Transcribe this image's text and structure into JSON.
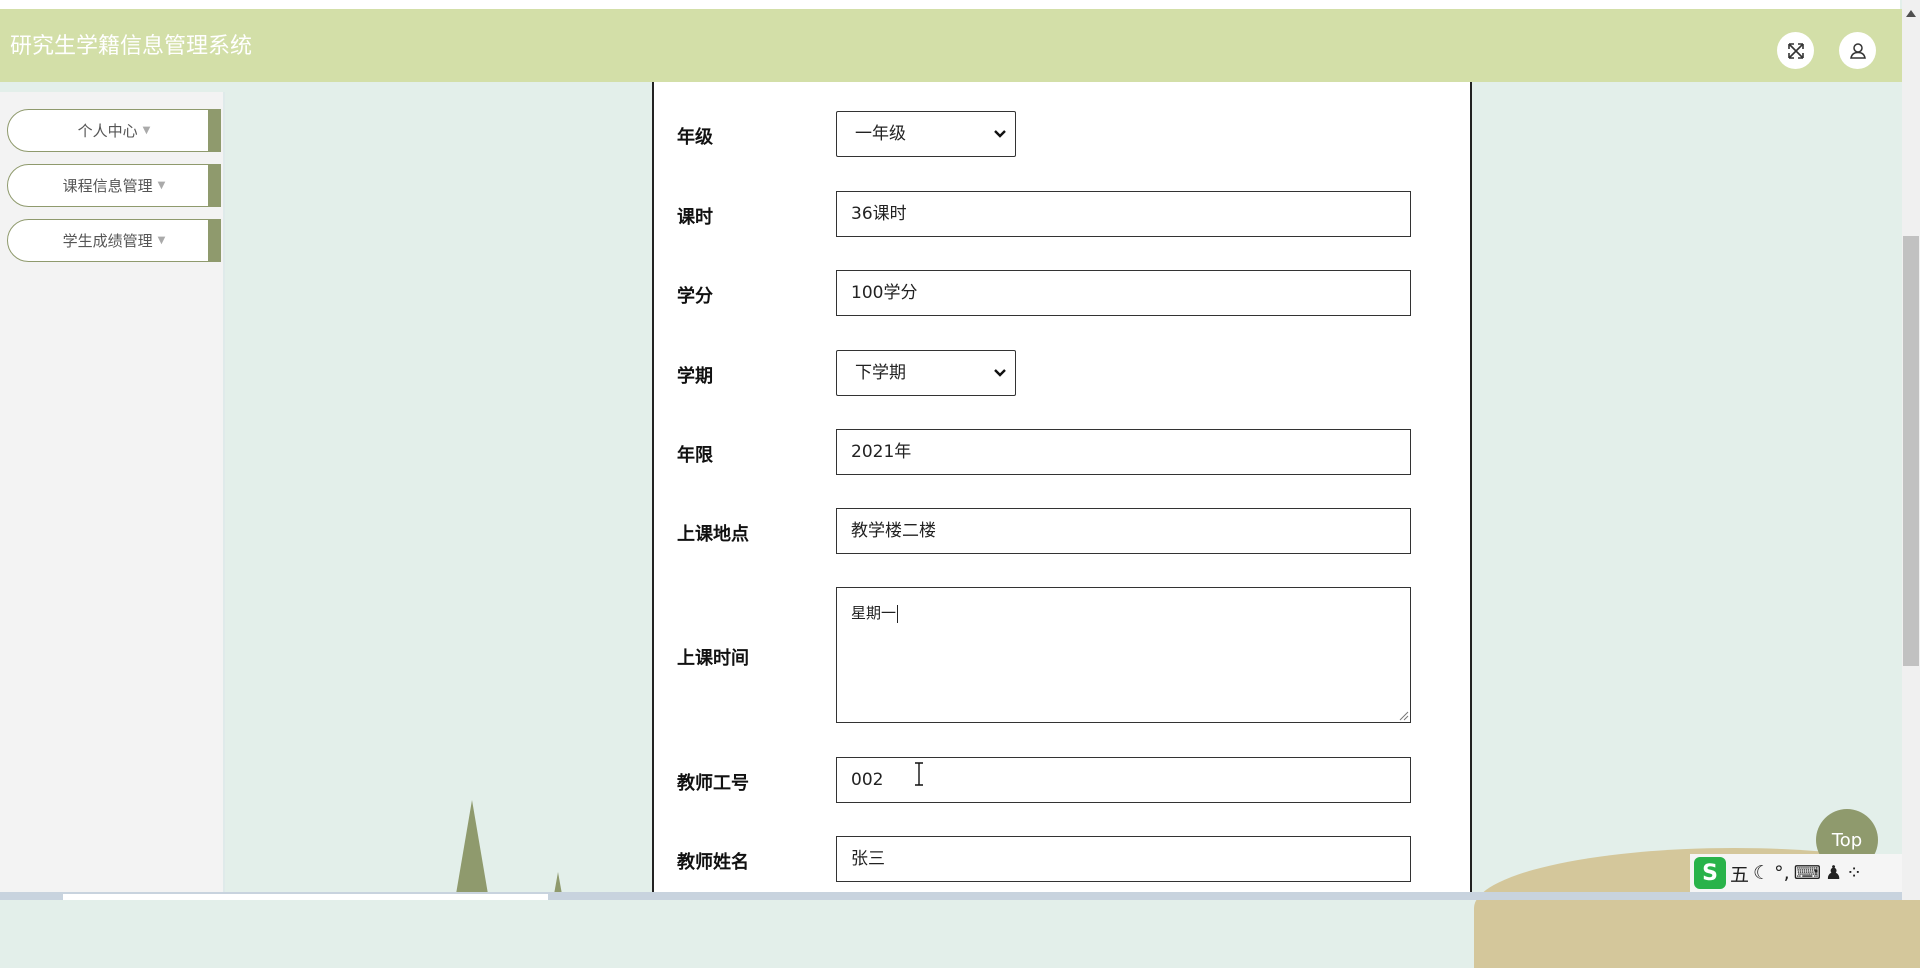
{
  "header": {
    "title": "研究生学籍信息管理系统"
  },
  "icons": {
    "fullscreen": "expand-arrows-icon",
    "user": "user-icon"
  },
  "sidebar": {
    "items": [
      {
        "label": "个人中心"
      },
      {
        "label": "课程信息管理"
      },
      {
        "label": "学生成绩管理"
      }
    ]
  },
  "form": {
    "grade": {
      "label": "年级",
      "value": "一年级"
    },
    "hours": {
      "label": "课时",
      "value": "36课时"
    },
    "credits": {
      "label": "学分",
      "value": "100学分"
    },
    "semester": {
      "label": "学期",
      "value": "下学期"
    },
    "year": {
      "label": "年限",
      "value": "2021年"
    },
    "location": {
      "label": "上课地点",
      "value": "教学楼二楼"
    },
    "time": {
      "label": "上课时间",
      "value": "星期一"
    },
    "teacher_id": {
      "label": "教师工号",
      "value": "002"
    },
    "teacher_name": {
      "label": "教师姓名",
      "value": "张三"
    }
  },
  "back_to_top": {
    "label": "Top"
  },
  "ime_toolbar": {
    "mode": "五",
    "items": [
      "moon-icon",
      "punctuation-icon",
      "keyboard-icon",
      "person-icon",
      "grid-icon"
    ]
  },
  "colors": {
    "header": "#d3dfa8",
    "accent": "#8f9a6d",
    "background": "#e3efea"
  }
}
